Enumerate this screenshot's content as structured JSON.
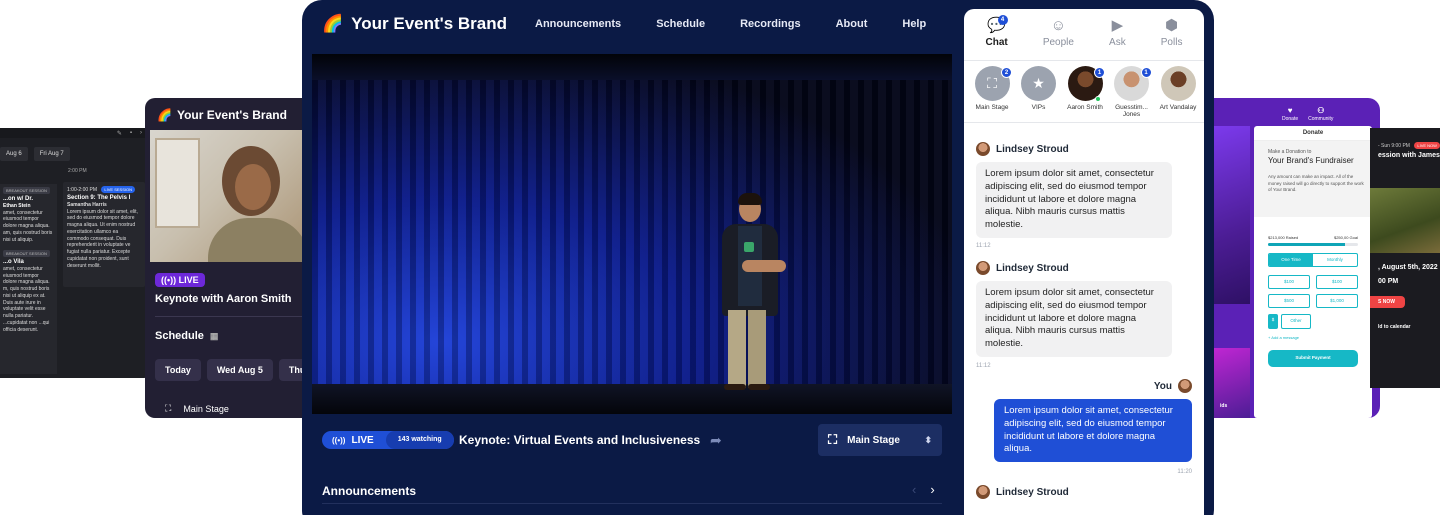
{
  "brand": {
    "name": "Your Event's Brand",
    "logo_icon": "rainbow-icon"
  },
  "nav": {
    "links": [
      "Announcements",
      "Schedule",
      "Recordings",
      "About",
      "Help"
    ]
  },
  "stream": {
    "live_label": "LIVE",
    "watching": "143 watching",
    "title": "Keynote: Virtual Events and Inclusiveness",
    "stage_selected": "Main Stage"
  },
  "announcements": {
    "heading": "Announcements"
  },
  "chat": {
    "tabs": [
      {
        "label": "Chat",
        "icon": "chat-icon",
        "badge": "4",
        "active": true
      },
      {
        "label": "People",
        "icon": "smile-icon",
        "active": false
      },
      {
        "label": "Ask",
        "icon": "video-icon",
        "active": false
      },
      {
        "label": "Polls",
        "icon": "cube-icon",
        "active": false
      }
    ],
    "rooms": [
      {
        "label": "Main Stage",
        "badge": "2"
      },
      {
        "label": "VIPs",
        "badge": ""
      },
      {
        "label": "Aaron Smith",
        "badge": "1"
      },
      {
        "label": "Guesstim... Jones",
        "badge": "1"
      },
      {
        "label": "Art Vandalay",
        "badge": ""
      }
    ],
    "messages": [
      {
        "author": "Lindsey Stroud",
        "text": "Lorem ipsum dolor sit amet, consectetur adipiscing elit, sed do eiusmod tempor incididunt ut labore et dolore magna aliqua. Nibh mauris cursus mattis molestie.",
        "time": "11:12"
      },
      {
        "author": "Lindsey Stroud",
        "text": "Lorem ipsum dolor sit amet, consectetur adipiscing elit, sed do eiusmod tempor incididunt ut labore et dolore magna aliqua. Nibh mauris cursus mattis molestie.",
        "time": "11:12"
      },
      {
        "author": "You",
        "text": "Lorem ipsum dolor sit amet, consectetur adipiscing elit, sed do eiusmod tempor incididunt ut labore et dolore magna aliqua.",
        "time": "11:20"
      },
      {
        "author": "Lindsey Stroud",
        "text": "",
        "time": ""
      }
    ]
  },
  "left_card": {
    "brand": "Your Event's Brand",
    "live_label": "LIVE",
    "session_title": "Keynote with Aaron Smith",
    "schedule_heading": "Schedule",
    "days": [
      "Today",
      "Wed Aug 5",
      "Thu"
    ],
    "stage_label": "Main Stage"
  },
  "far_left_card": {
    "days": [
      "Aug 6",
      "Fri Aug 7"
    ],
    "time": "2:00 PM",
    "col1_badge": "BREAKOUT SESSION",
    "col1_title": "...on w/ Dr.",
    "col1_speaker": "Ethan Stein",
    "col1_text": "amet, consectetur eiusmod tempor dolore magna aliqua. am, quis nostrud boris nisi ut aliquip.",
    "col1_badge2": "BREAKOUT SESSION",
    "col1_title2": "...o Vila",
    "col1_text2": "amet, consectetur eiusmod tempor dolore magna aliqua. m, quis nostrud boris nisi ut aliquip ex at. Duis aute irure in voluptate velit esse nulla pariatur. ...cupidatat non ...qui officia deserunt.",
    "col2_time": "1:00-2:00 PM",
    "col2_live": "LIVE SESSION",
    "col2_title": "Section 9: The Pelvis I",
    "col2_speaker": "Samantha Harris",
    "col2_text": "Lorem ipsum dolor sit amet, elit, sed do eiusmod tempor dolore magna aliqua. Ut enim nostrud exercitation ullamco ea commodo consequat. Duis reprehenderit in voluptate ve fugiat nulla pariatur. Excepte cupidatat non proident, sunt deserunt mollit."
  },
  "donate_card": {
    "nav_donate": "Donate",
    "nav_community": "Community",
    "panel_title": "Donate",
    "make_donation": "Make a Donation to",
    "fundraiser": "Your Brand's Fundraiser",
    "description": "Any amount can make an impact. All of the money raised will go directly to support the work of Your Brand.",
    "raised": "$213,000 Raised",
    "goal": "$250,00 Goal",
    "progress": 0.85,
    "freq": [
      "One Time",
      "Monthly"
    ],
    "amounts": [
      "$100",
      "$100",
      "$500",
      "$1,000"
    ],
    "currency": "$",
    "other": "Other",
    "add_message": "+ Add a message",
    "submit": "Submit Payment",
    "kids_label": "ids"
  },
  "far_right_card": {
    "time": "- Sun 9:00 PM",
    "live": "LIVE NOW",
    "title": "ession with James",
    "date": ", August 5th, 2022",
    "time2": "00 PM",
    "button": "S NOW",
    "calendar": "ld to calendar"
  }
}
